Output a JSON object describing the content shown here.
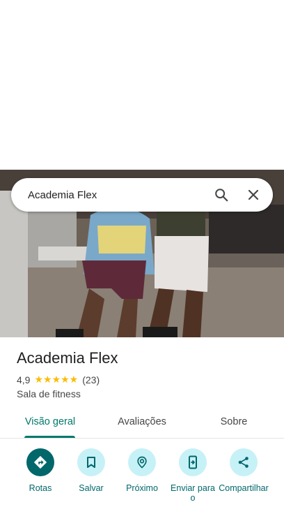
{
  "search": {
    "query": "Academia Flex"
  },
  "place": {
    "name": "Academia Flex",
    "rating": "4,9",
    "stars": "★★★★★",
    "review_count": "(23)",
    "category": "Sala de fitness"
  },
  "tabs": [
    {
      "label": "Visão geral",
      "active": true
    },
    {
      "label": "Avaliações",
      "active": false
    },
    {
      "label": "Sobre",
      "active": false
    }
  ],
  "actions": [
    {
      "label": "Rotas",
      "icon": "directions-icon"
    },
    {
      "label": "Salvar",
      "icon": "bookmark-icon"
    },
    {
      "label": "Próximo",
      "icon": "nearby-icon"
    },
    {
      "label": "Enviar para o",
      "icon": "send-to-phone-icon"
    },
    {
      "label": "Compartilhar",
      "icon": "share-icon"
    }
  ],
  "colors": {
    "accent": "#00796b",
    "action_bg": "#c6f1f7",
    "primary_action": "#00676b",
    "star": "#fbbc04"
  }
}
